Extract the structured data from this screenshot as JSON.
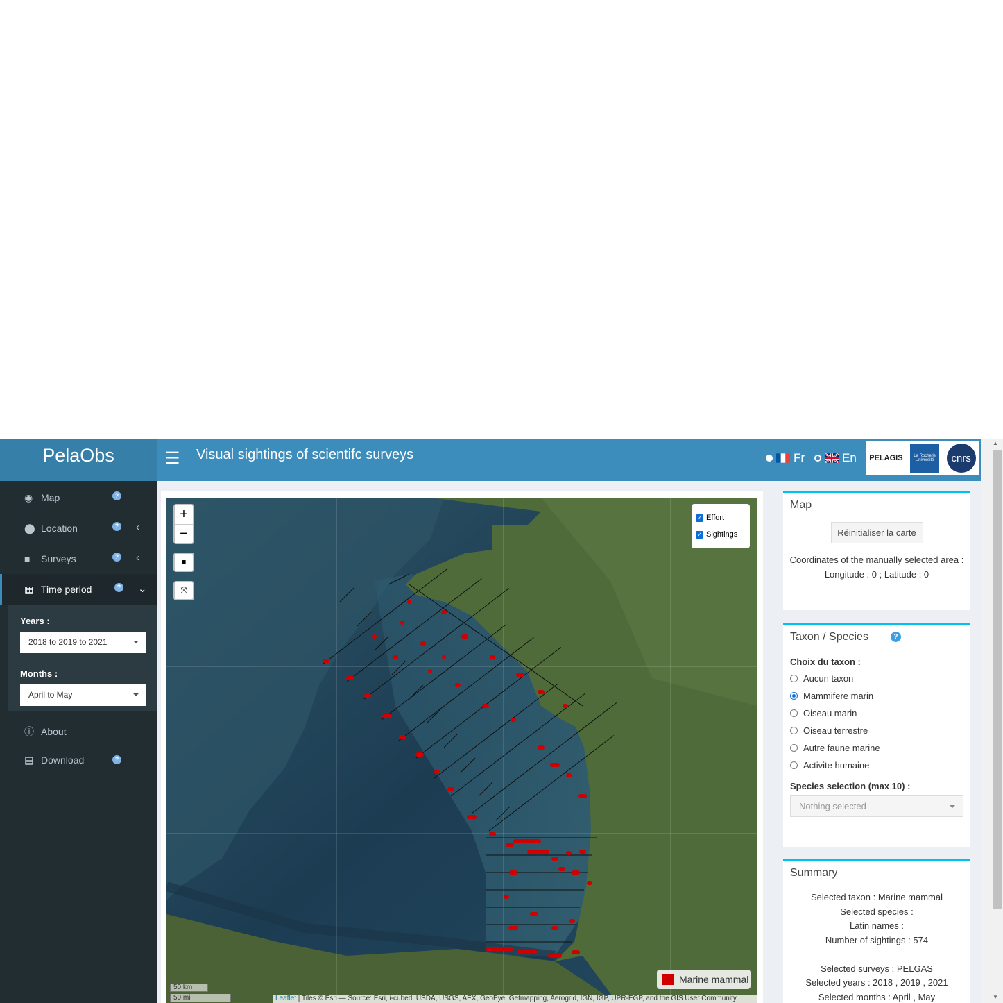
{
  "header": {
    "logo_text": "PelaObs",
    "title": "Visual sightings of scientifc surveys",
    "lang_fr": "Fr",
    "lang_en": "En",
    "partner_logo_pelagis": "PELAGIS",
    "partner_logo_lr": "La Rochelle Université",
    "partner_logo_cnrs": "cnrs"
  },
  "sidebar": {
    "items": [
      {
        "label": "Map",
        "icon": "globe-icon"
      },
      {
        "label": "Location",
        "icon": "map-pin-icon"
      },
      {
        "label": "Surveys",
        "icon": "camera-icon"
      },
      {
        "label": "Time period",
        "icon": "calendar-icon"
      },
      {
        "label": "About",
        "icon": "info-icon"
      },
      {
        "label": "Download",
        "icon": "download-file-icon"
      }
    ],
    "time_period": {
      "years_label": "Years :",
      "years_value": "2018 to 2019 to 2021",
      "months_label": "Months :",
      "months_value": "April to May"
    }
  },
  "map": {
    "zoom_in": "+",
    "zoom_out": "−",
    "layers": {
      "effort": "Effort",
      "sightings": "Sightings"
    },
    "legend_label": "Marine mammal",
    "legend_color": "#d00000",
    "scale_km": "50 km",
    "scale_mi": "50 mi",
    "attribution_link": "Leaflet",
    "attribution_text": " | Tiles © Esri — Source: Esri, i-cubed, USDA, USGS, AEX, GeoEye, Getmapping, Aerogrid, IGN, IGP, UPR-EGP, and the GIS User Community"
  },
  "panel_map": {
    "title": "Map",
    "reset_button": "Réinitialiser la carte",
    "coords_label": "Coordinates of the manually selected area :",
    "coords_value": "Longitude : 0 ; Latitude : 0"
  },
  "panel_taxon": {
    "title": "Taxon / Species",
    "choice_label": "Choix du taxon :",
    "options": [
      "Aucun taxon",
      "Mammifere marin",
      "Oiseau marin",
      "Oiseau terrestre",
      "Autre faune marine",
      "Activite humaine"
    ],
    "selected_index": 1,
    "species_label": "Species selection (max 10) :",
    "species_placeholder": "Nothing selected"
  },
  "panel_summary": {
    "title": "Summary",
    "lines": [
      "Selected taxon : Marine mammal",
      "Selected species :",
      "Latin names :",
      "Number of sightings : 574",
      "",
      "Selected surveys : PELGAS",
      "Selected years : 2018 , 2019 , 2021",
      "Selected months : April , May"
    ]
  },
  "colors": {
    "header": "#3c8dbc",
    "logo_bg": "#367fa9",
    "sidebar": "#222d32",
    "accent": "#00c0ef",
    "sighting": "#d00000"
  }
}
